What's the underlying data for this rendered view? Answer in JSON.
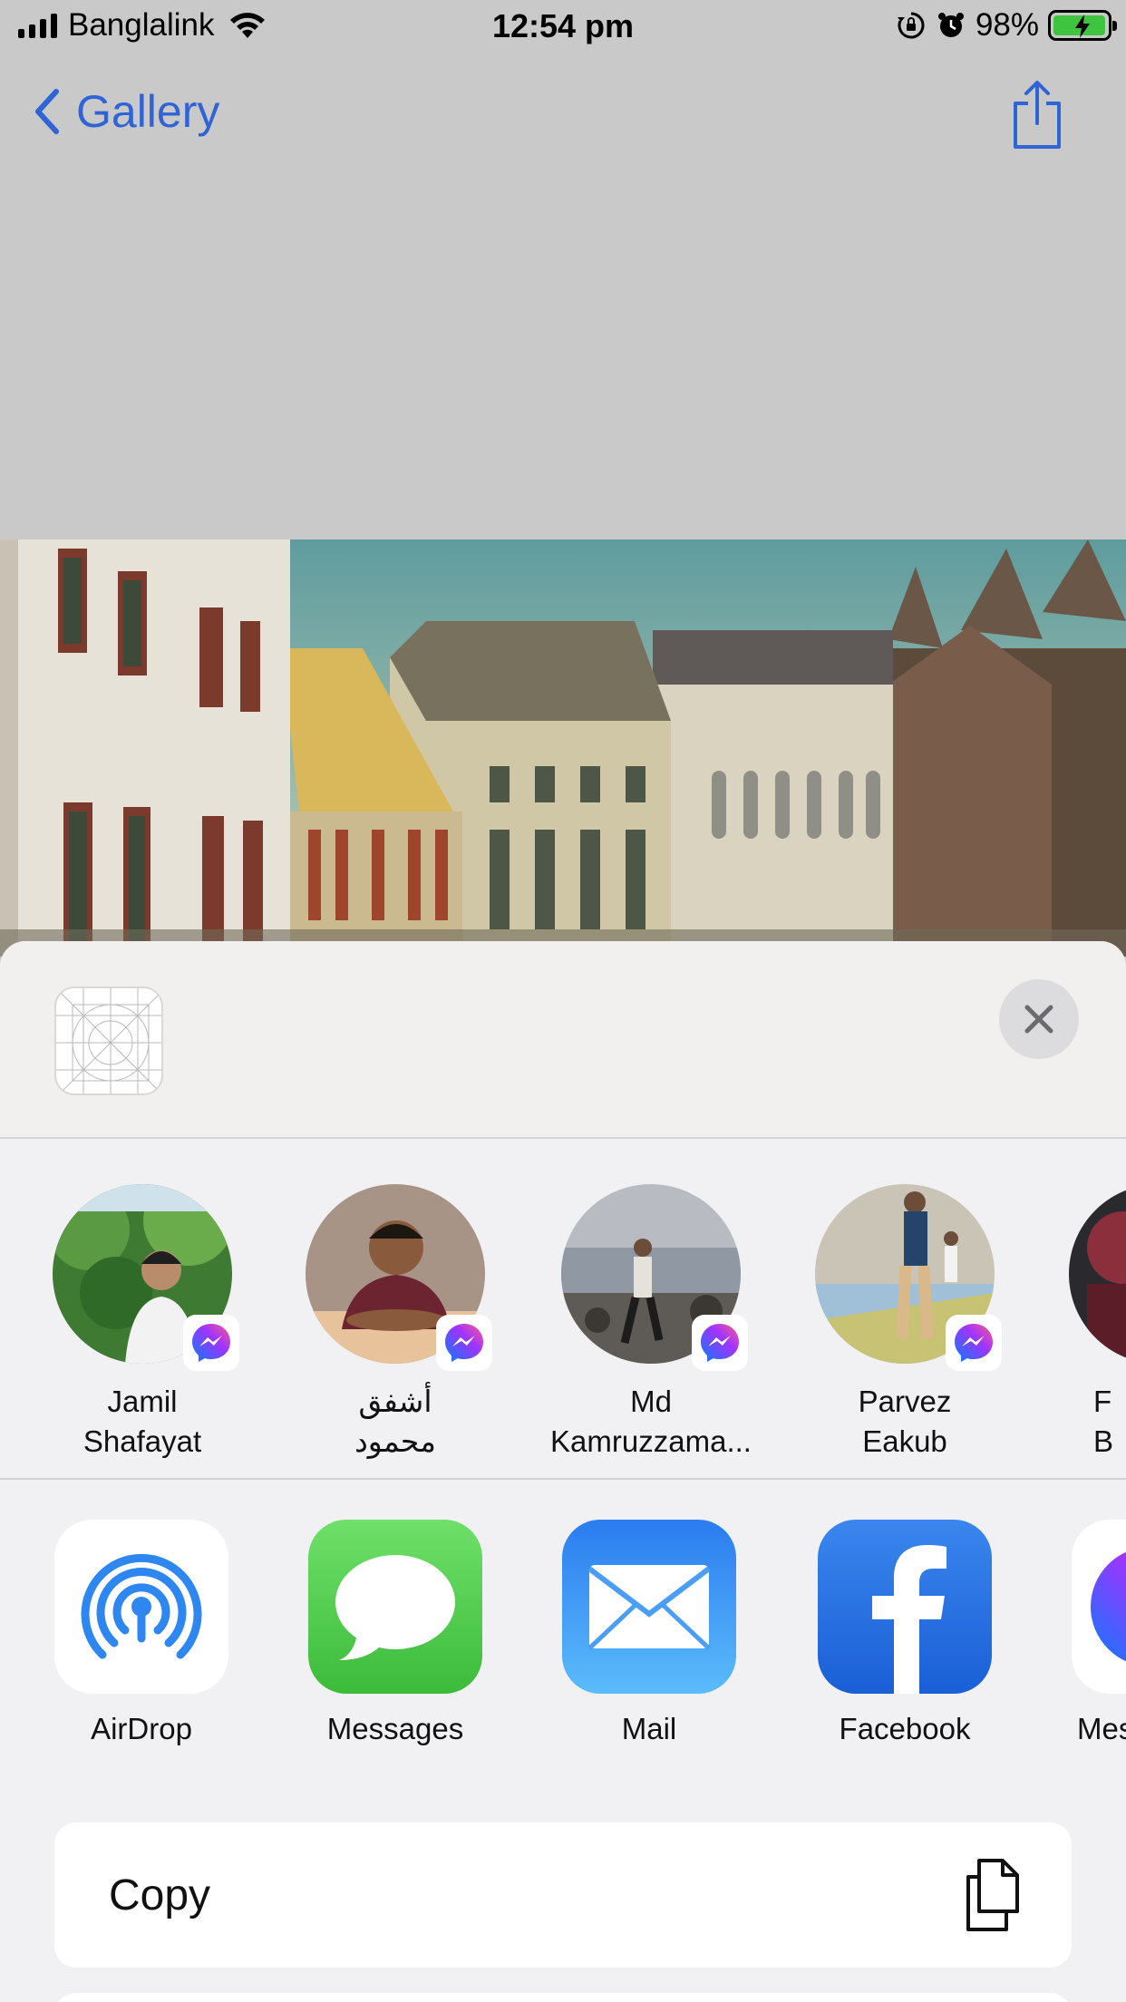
{
  "status_bar": {
    "carrier": "Banglalink",
    "time": "12:54 pm",
    "battery": "98%",
    "battery_level": 0.98,
    "icons": [
      "signal-icon",
      "wifi-icon",
      "orientation-lock-icon",
      "alarm-icon",
      "battery-icon"
    ]
  },
  "nav": {
    "back_label": "Gallery",
    "back_icon": "chevron-left-icon",
    "share_icon": "share-icon",
    "accent_color": "#2f63d6"
  },
  "sheet": {
    "close_icon": "close-icon",
    "contacts": [
      {
        "line1": "Jamil",
        "line2": "Shafayat",
        "badge": "messenger-icon"
      },
      {
        "line1": "أشفق",
        "line2": "محمود",
        "badge": "messenger-icon"
      },
      {
        "line1": "Md",
        "line2": "Kamruzzama...",
        "badge": "messenger-icon"
      },
      {
        "line1": "Parvez",
        "line2": "Eakub",
        "badge": "messenger-icon"
      },
      {
        "line1": "F",
        "line2": "B",
        "badge": "messenger-icon"
      }
    ],
    "apps": [
      {
        "label": "AirDrop",
        "icon": "airdrop-icon"
      },
      {
        "label": "Messages",
        "icon": "messages-icon"
      },
      {
        "label": "Mail",
        "icon": "mail-icon"
      },
      {
        "label": "Facebook",
        "icon": "facebook-icon"
      },
      {
        "label": "Mes",
        "icon": "messenger-app-icon"
      }
    ],
    "actions": [
      {
        "label": "Copy",
        "icon": "copy-icon"
      }
    ]
  }
}
